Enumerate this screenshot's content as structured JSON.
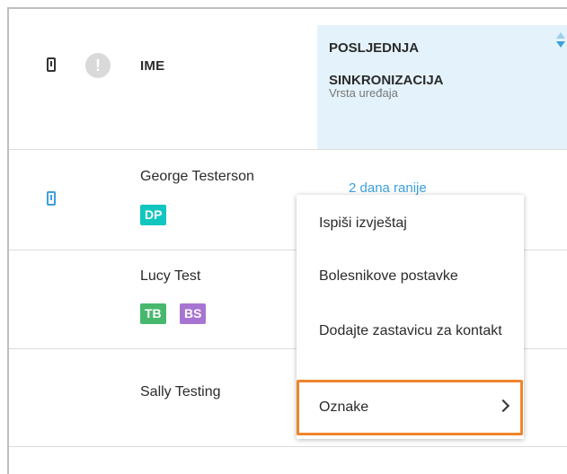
{
  "table": {
    "header": {
      "name_col": "IME",
      "sync_title_line1": "POSLJEDNJA",
      "sync_title_line2": "SINKRONIZACIJA",
      "sync_subtitle": "Vrsta uređaja",
      "icons": [
        "device-icon",
        "alert-icon"
      ]
    },
    "rows": [
      {
        "name": "George Testerson",
        "badges": [
          {
            "text": "DP",
            "color": "#12c6c0"
          }
        ],
        "last_sync": "2 dana ranije",
        "device_icon": "device-icon"
      },
      {
        "name": "Lucy Test",
        "badges": [
          {
            "text": "TB",
            "color": "#47b86e"
          },
          {
            "text": "BS",
            "color": "#a874d1"
          }
        ]
      },
      {
        "name": "Sally Testing",
        "badges": []
      }
    ]
  },
  "context_menu": {
    "items": [
      "Ispiši izvještaj",
      "Bolesnikove postavke",
      "Dodajte zastavicu za kontakt",
      "Oznake"
    ],
    "highlighted": "Oznake",
    "highlight_color": "#f0852d"
  },
  "colors": {
    "accent": "#3ba0dc",
    "header_bg": "#e4f3fb"
  }
}
